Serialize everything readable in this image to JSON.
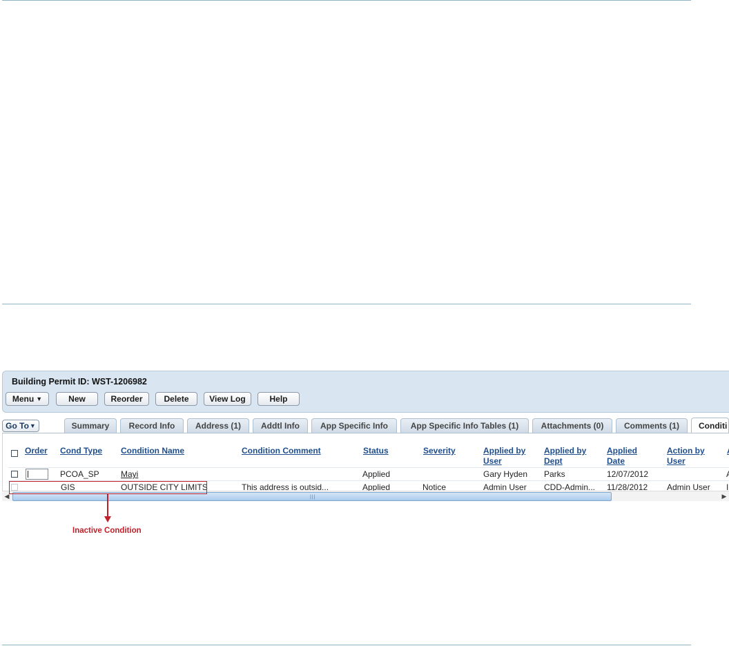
{
  "window": {
    "title": "Building Permit ID: WST-1206982"
  },
  "toolbar": {
    "menu_label": "Menu",
    "new_label": "New",
    "reorder_label": "Reorder",
    "delete_label": "Delete",
    "view_log_label": "View Log",
    "help_label": "Help"
  },
  "nav": {
    "goto_label": "Go To"
  },
  "tabs": [
    {
      "label": "Summary"
    },
    {
      "label": "Record Info"
    },
    {
      "label": "Address (1)"
    },
    {
      "label": "Addtl Info"
    },
    {
      "label": "App Specific Info"
    },
    {
      "label": "App Specific Info Tables (1)"
    },
    {
      "label": "Attachments (0)"
    },
    {
      "label": "Comments (1)"
    },
    {
      "label": "Conditi",
      "active": true
    }
  ],
  "grid": {
    "headers": {
      "order": "Order",
      "cond_type": "Cond Type",
      "condition_name": "Condition Name",
      "condition_comment": "Condition Comment",
      "status": "Status",
      "severity": "Severity",
      "applied_by_user_1": "Applied by",
      "applied_by_user_2": "User",
      "applied_by_dept_1": "Applied by",
      "applied_by_dept_2": "Dept",
      "applied_date_1": "Applied",
      "applied_date_2": "Date",
      "action_by_user_1": "Action by",
      "action_by_user_2": "User",
      "next_partial": "A"
    },
    "rows": [
      {
        "order": "",
        "cond_type": "PCOA_SP",
        "condition_name": "Mayi",
        "condition_comment": "",
        "status": "Applied",
        "severity": "",
        "applied_by_user": "Gary Hyden",
        "applied_by_dept": "Parks",
        "applied_date": "12/07/2012",
        "action_by_user": "",
        "next_partial": "A"
      },
      {
        "order": "",
        "cond_type": "GIS",
        "condition_name": "OUTSIDE CITY LIMITS",
        "condition_comment": "This address is outsid...",
        "status": "Applied",
        "severity": "Notice",
        "applied_by_user": "Admin User",
        "applied_by_dept": "CDD-Admin...",
        "applied_date": "11/28/2012",
        "action_by_user": "Admin User",
        "next_partial": "I"
      }
    ]
  },
  "annotation": {
    "label": "Inactive Condition",
    "color": "#c0202a"
  },
  "icons": {
    "menu_caret": "▼",
    "goto_caret": "▼",
    "scroll_left": "◀",
    "scroll_right": "▶",
    "scroll_grip": "|||"
  },
  "colors": {
    "header_link": "#1f4e8c",
    "panel_bg": "#d9e6f2",
    "rule": "#8fb4c4"
  }
}
